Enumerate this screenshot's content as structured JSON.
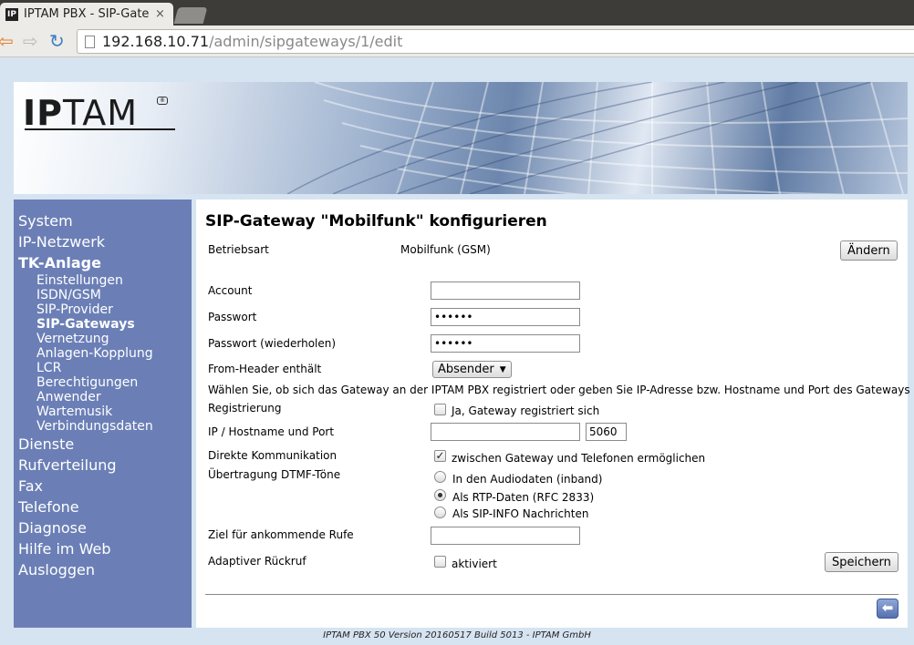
{
  "browser": {
    "tab_title": "IPTAM PBX - SIP-Gateways",
    "tab_close": "×",
    "favicon_text": "IP",
    "url_host": "192.168.10.71",
    "url_path": "/admin/sipgateways/1/edit"
  },
  "brand": {
    "logo_ip": "IP",
    "logo_rest": "TAM"
  },
  "sidebar": {
    "items": [
      {
        "label": "System"
      },
      {
        "label": "IP-Netzwerk"
      },
      {
        "label": "TK-Anlage",
        "active": true
      }
    ],
    "sub_items": [
      {
        "label": "Einstellungen"
      },
      {
        "label": "ISDN/GSM"
      },
      {
        "label": "SIP-Provider"
      },
      {
        "label": "SIP-Gateways",
        "active": true
      },
      {
        "label": "Vernetzung"
      },
      {
        "label": "Anlagen-Kopplung"
      },
      {
        "label": "LCR"
      },
      {
        "label": "Berechtigungen"
      },
      {
        "label": "Anwender"
      },
      {
        "label": "Wartemusik"
      },
      {
        "label": "Verbindungsdaten"
      }
    ],
    "items_after": [
      {
        "label": "Dienste"
      },
      {
        "label": "Rufverteilung"
      },
      {
        "label": "Fax"
      },
      {
        "label": "Telefone"
      },
      {
        "label": "Diagnose"
      },
      {
        "label": "Hilfe im Web"
      },
      {
        "label": "Ausloggen"
      }
    ]
  },
  "main": {
    "title": "SIP-Gateway \"Mobilfunk\" konfigurieren",
    "betriebsart_label": "Betriebsart",
    "betriebsart_value": "Mobilfunk (GSM)",
    "aendern_button": "Ändern",
    "account_label": "Account",
    "account_value": "",
    "passwort_label": "Passwort",
    "passwort_value": "••••••",
    "passwort2_label": "Passwort (wiederholen)",
    "passwort2_value": "••••••",
    "from_header_label": "From-Header enthält",
    "from_header_value": "Absender",
    "hint_text": "Wählen Sie, ob sich das Gateway an der IPTAM PBX registriert oder geben Sie IP-Adresse bzw. Hostname und Port des Gateways an.",
    "registrierung_label": "Registrierung",
    "registrierung_checkbox_label": "Ja, Gateway registriert sich",
    "registrierung_checked": false,
    "ip_label": "IP / Hostname und Port",
    "ip_value": "",
    "port_value": "5060",
    "direkt_label": "Direkte Kommunikation",
    "direkt_checkbox_label": "zwischen Gateway und Telefonen ermöglichen",
    "direkt_checked": true,
    "dtmf_label": "Übertragung DTMF-Töne",
    "dtmf_options": [
      {
        "label": "In den Audiodaten (inband)",
        "checked": false
      },
      {
        "label": "Als RTP-Daten (RFC 2833)",
        "checked": true
      },
      {
        "label": "Als SIP-INFO Nachrichten",
        "checked": false
      }
    ],
    "ziel_label": "Ziel für ankommende Rufe",
    "ziel_value": "",
    "rueckruf_label": "Adaptiver Rückruf",
    "rueckruf_checkbox_label": "aktiviert",
    "rueckruf_checked": false,
    "speichern_button": "Speichern",
    "back_icon_glyph": "⬅"
  },
  "footer": {
    "text": "IPTAM PBX 50 Version 20160517 Build 5013 - IPTAM GmbH"
  },
  "icons": [
    "back-arrow-icon",
    "forward-arrow-icon",
    "reload-icon",
    "page-icon",
    "back-button-icon"
  ]
}
